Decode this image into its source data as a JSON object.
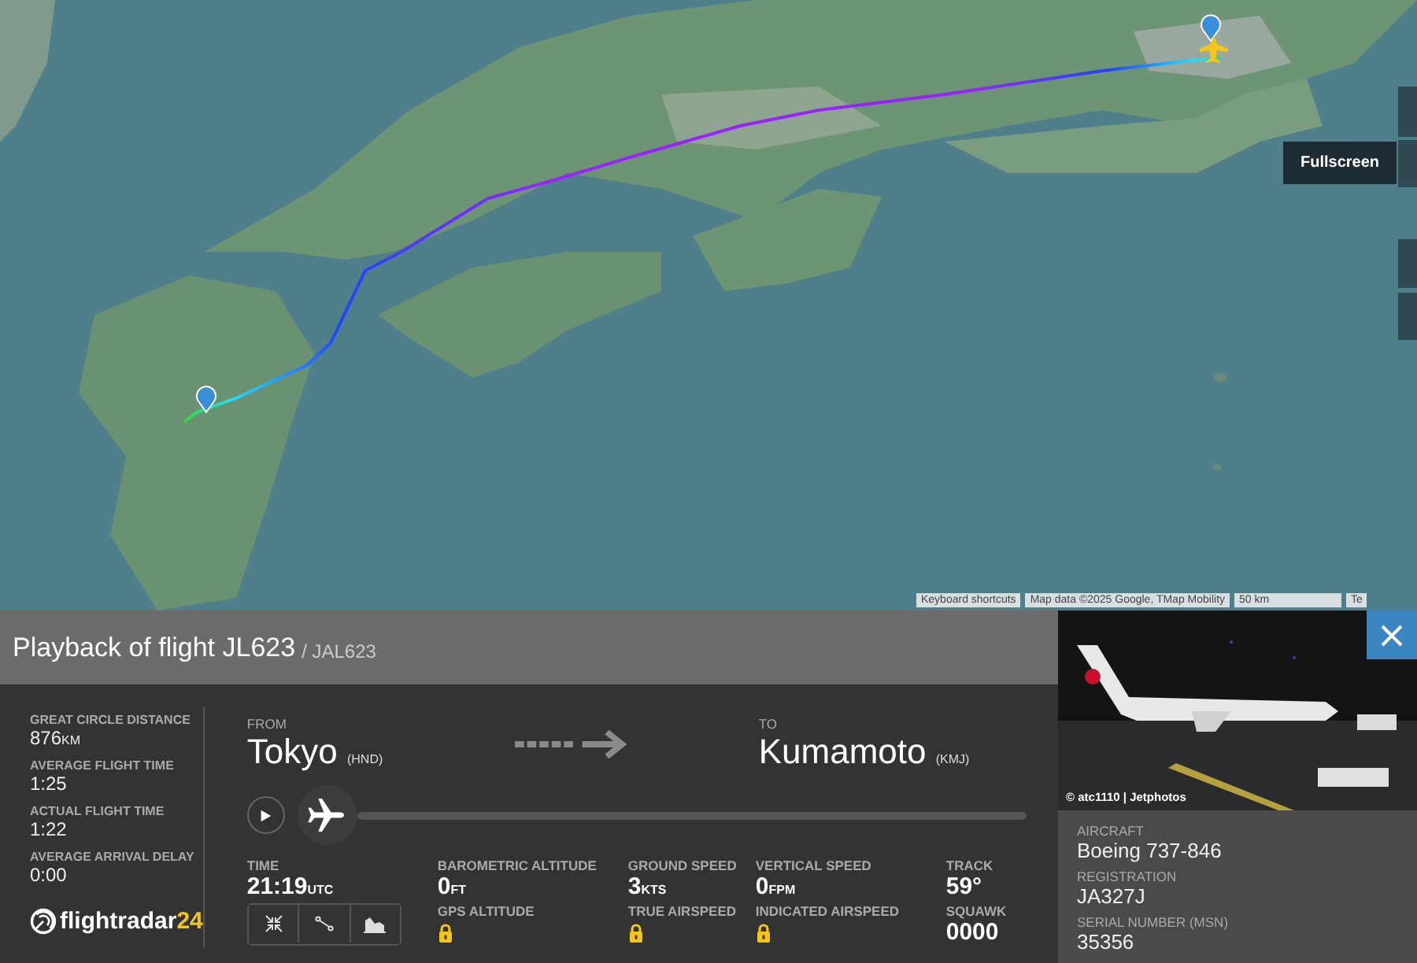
{
  "map": {
    "kind": "picture",
    "tooltip": "Fullscreen",
    "attribution": [
      {
        "text": "Keyboard shortcuts",
        "kind": "link"
      },
      {
        "text": "Map data ©2025 Google, TMap Mobility",
        "kind": "text"
      },
      {
        "text": "50 km",
        "kind": "scale"
      },
      {
        "text": "Te",
        "kind": "link"
      }
    ]
  },
  "header": {
    "title": "Playback of flight JL623",
    "callsign": "/ JAL623"
  },
  "stats": [
    {
      "label": "GREAT CIRCLE DISTANCE",
      "value": "876",
      "unit": "KM"
    },
    {
      "label": "AVERAGE FLIGHT TIME",
      "value": "1:25"
    },
    {
      "label": "ACTUAL FLIGHT TIME",
      "value": "1:22"
    },
    {
      "label": "AVERAGE ARRIVAL DELAY",
      "value": "0:00"
    }
  ],
  "logo": {
    "text": "flightradar",
    "suffix": "24"
  },
  "from": {
    "label": "FROM",
    "city": "Tokyo",
    "code": "(HND)"
  },
  "to": {
    "label": "TO",
    "city": "Kumamoto",
    "code": "(KMJ)"
  },
  "playback": {
    "level": 0
  },
  "readings": [
    {
      "label": "TIME",
      "value": "21:19",
      "unit": "UTC"
    },
    {
      "label": "BAROMETRIC ALTITUDE",
      "value": "0",
      "unit": "FT"
    },
    {
      "label": "GROUND SPEED",
      "value": "3",
      "unit": "KTS"
    },
    {
      "label": "VERTICAL SPEED",
      "value": "0",
      "unit": "FPM"
    },
    {
      "label": "TRACK",
      "value": "59°"
    },
    {
      "kind": "buttons"
    },
    {
      "label": "GPS ALTITUDE",
      "locked": true
    },
    {
      "label": "TRUE AIRSPEED",
      "locked": true
    },
    {
      "label": "INDICATED AIRSPEED",
      "locked": true
    },
    {
      "label": "SQUAWK",
      "value": "0000"
    }
  ],
  "aircraft": {
    "photo_credit": "© atc1110 | Jetphotos",
    "details": [
      {
        "label": "AIRCRAFT",
        "value": "Boeing 737-846"
      },
      {
        "label": "REGISTRATION",
        "value": "JA327J"
      },
      {
        "label": "SERIAL NUMBER (MSN)",
        "value": "35356"
      }
    ]
  }
}
